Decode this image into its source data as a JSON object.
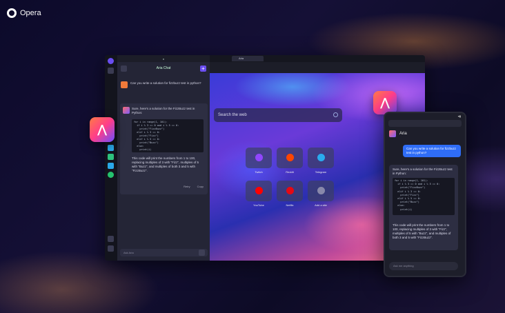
{
  "brand": {
    "name": "Opera"
  },
  "browser": {
    "panel": {
      "title": "Aria Chat",
      "question": "Can you write a solution for fizzbuzz test in python?",
      "answer_intro": "Sure, here's a solution for the FizzBuzz test in Python:",
      "code": "for i in range(1, 101):\n  if i % 3 == 0 and i % 5 == 0:\n    print(\"FizzBuzz\")\n  elif i % 3 == 0:\n    print(\"Fizz\")\n  elif i % 5 == 0:\n    print(\"Buzz\")\n  else:\n    print(i)",
      "answer_outro": "This code will print the numbers from 1 to 100, replacing multiples of 3 with \"Fizz\", multiples of 5 with \"Buzz\", and multiples of both 3 and 5 with \"FizzBuzz\".",
      "action_retry": "Retry",
      "action_copy": "Copy",
      "input_placeholder": "Ask Aria"
    },
    "tab": {
      "label": "Aria"
    },
    "search": {
      "placeholder": "Search the web"
    },
    "tiles": [
      {
        "label": "Twitch",
        "color": "#9146ff"
      },
      {
        "label": "Reddit",
        "color": "#ff4500"
      },
      {
        "label": "Telegram",
        "color": "#2aabee"
      },
      {
        "label": "YouTube",
        "color": "#ff0000"
      },
      {
        "label": "Netflix",
        "color": "#e50914"
      },
      {
        "label": "Add a site",
        "color": "#8888aa"
      }
    ]
  },
  "phone": {
    "assistant_name": "Aria",
    "user_message": "Can you write a solution for fizzbuzz test in python?",
    "answer_intro": "Sure, here's a solution for the FizzBuzz test in Python:",
    "code": "for i in range(1, 101):\n  if i % 3 == 0 and i % 5 == 0:\n    print(\"FizzBuzz\")\n  elif i % 3 == 0:\n    print(\"Fizz\")\n  elif i % 5 == 0:\n    print(\"Buzz\")\n  else:\n    print(i)",
    "answer_outro": "This code will print the numbers from 1 to 100, replacing multiples of 3 with \"Fizz\", multiples of 5 with \"Buzz\", and multiples of both 3 and 5 with \"FizzBuzz\".",
    "input_placeholder": "Ask me anything"
  },
  "colors": {
    "accent": "#6a4df0",
    "user_bubble": "#2f6df6"
  }
}
